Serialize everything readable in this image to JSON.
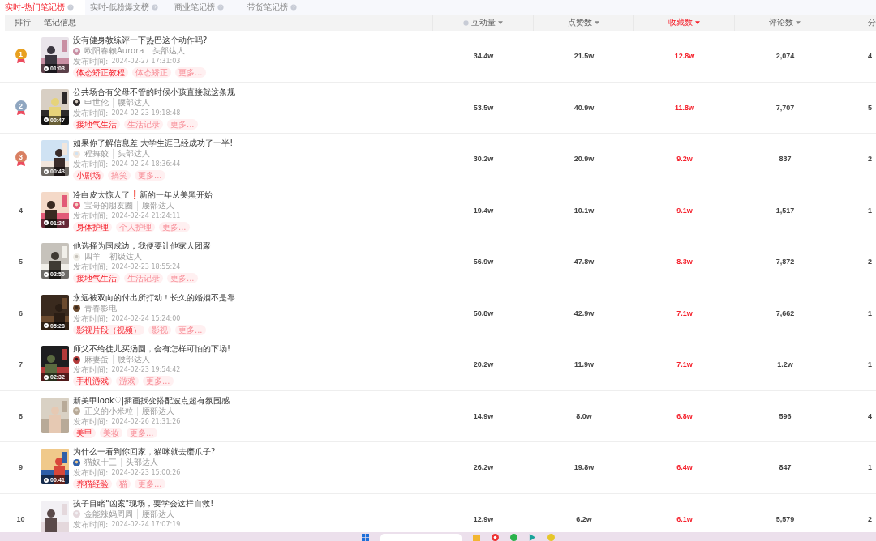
{
  "tabs": [
    {
      "label": "实时-热门笔记榜",
      "selected": true
    },
    {
      "label": "实时-低粉爆文榜",
      "selected": false
    },
    {
      "label": "商业笔记榜",
      "selected": false
    },
    {
      "label": "带货笔记榜",
      "selected": false
    }
  ],
  "columns": [
    {
      "label": "排行",
      "kind": "rank",
      "sorted": false
    },
    {
      "label": "笔记信息",
      "kind": "note",
      "sorted": false
    },
    {
      "label": "互动量",
      "kind": "hinted",
      "sorted": false
    },
    {
      "label": "点赞数",
      "kind": "metric",
      "sorted": false
    },
    {
      "label": "收藏数",
      "kind": "metric",
      "sorted": true
    },
    {
      "label": "评论数",
      "kind": "metric",
      "sorted": false
    },
    {
      "label": "分",
      "kind": "cut",
      "sorted": false
    }
  ],
  "rows": [
    {
      "rank": "1",
      "color": "#e8a020",
      "title": "没有健身教练评一下热巴这个动作吗?",
      "author": "欧阳春赖Aurora",
      "level": "头部达人",
      "published_label": "发布时间:",
      "published": "2024-02-27 17:31:03",
      "duration": "01:03",
      "tags": [
        {
          "label": "体态矫正教程",
          "kind": "category"
        },
        {
          "label": "体态矫正",
          "kind": "topic"
        },
        {
          "label": "更多...",
          "kind": "more"
        }
      ],
      "metrics": [
        "34.4w",
        "21.5w",
        "12.8w",
        "2,074",
        "4"
      ]
    },
    {
      "rank": "2",
      "color": "#8fa6c0",
      "title": "公共场合有父母不管的时候小孩直接就这条规",
      "author": "申世伦",
      "level": "腰部达人",
      "published_label": "发布时间:",
      "published": "2024-02-23 19:18:48",
      "duration": "00:47",
      "tags": [
        {
          "label": "接地气生活",
          "kind": "category"
        },
        {
          "label": "生活记录",
          "kind": "topic"
        },
        {
          "label": "更多...",
          "kind": "more"
        }
      ],
      "metrics": [
        "53.5w",
        "40.9w",
        "11.8w",
        "7,707",
        "5"
      ]
    },
    {
      "rank": "3",
      "color": "#d98062",
      "title": "如果你了解信息差 大学生涯已经成功了一半!",
      "author": "程舞姣",
      "level": "头部达人",
      "published_label": "发布时间:",
      "published": "2024-02-24 18:36:44",
      "duration": "00:43",
      "tags": [
        {
          "label": "小剧场",
          "kind": "category"
        },
        {
          "label": "搞笑",
          "kind": "topic"
        },
        {
          "label": "更多...",
          "kind": "more"
        }
      ],
      "metrics": [
        "30.2w",
        "20.9w",
        "9.2w",
        "837",
        "2"
      ]
    },
    {
      "rank": "4",
      "title": "冷白皮太惊人了❗新的一年从美黑开始",
      "author": "宝哥的朋友圈",
      "level": "腰部达人",
      "published_label": "发布时间:",
      "published": "2024-02-24 21:24:11",
      "duration": "01:24",
      "tags": [
        {
          "label": "身体护理",
          "kind": "category"
        },
        {
          "label": "个人护理",
          "kind": "topic"
        },
        {
          "label": "更多...",
          "kind": "more"
        }
      ],
      "metrics": [
        "19.4w",
        "10.1w",
        "9.1w",
        "1,517",
        "1"
      ]
    },
    {
      "rank": "5",
      "title": "他选择为国戍边，我便要让他家人团聚",
      "author": "四羊",
      "level": "初级达人",
      "published_label": "发布时间:",
      "published": "2024-02-23 18:55:24",
      "duration": "02:50",
      "tags": [
        {
          "label": "接地气生活",
          "kind": "category"
        },
        {
          "label": "生活记录",
          "kind": "topic"
        },
        {
          "label": "更多...",
          "kind": "more"
        }
      ],
      "metrics": [
        "56.9w",
        "47.8w",
        "8.3w",
        "7,872",
        "2"
      ]
    },
    {
      "rank": "6",
      "title": "永远被双向的付出所打动！长久的婚姻不是靠",
      "author": "青春影电",
      "published_label": "发布时间:",
      "published": "2024-02-24 15:24:00",
      "duration": "05:28",
      "tags": [
        {
          "label": "影视片段（视频）",
          "kind": "category"
        },
        {
          "label": "影视",
          "kind": "topic"
        },
        {
          "label": "更多...",
          "kind": "more"
        }
      ],
      "metrics": [
        "50.8w",
        "42.9w",
        "7.1w",
        "7,662",
        "1"
      ]
    },
    {
      "rank": "7",
      "title": "师父不给徒儿买汤圆，会有怎样可怕的下场!",
      "author": "麻妻蛋",
      "level": "腰部达人",
      "published_label": "发布时间:",
      "published": "2024-02-23 19:54:42",
      "duration": "02:32",
      "tags": [
        {
          "label": "手机游戏",
          "kind": "category"
        },
        {
          "label": "游戏",
          "kind": "topic"
        },
        {
          "label": "更多...",
          "kind": "more"
        }
      ],
      "metrics": [
        "20.2w",
        "11.9w",
        "7.1w",
        "1.2w",
        "1"
      ]
    },
    {
      "rank": "8",
      "title": "新美甲look♡|插画扳变搭配波点超有氛围感",
      "author": "正义的小米粒",
      "level": "腰部达人",
      "published_label": "发布时间:",
      "published": "2024-02-26 21:31:26",
      "tags": [
        {
          "label": "美甲",
          "kind": "category"
        },
        {
          "label": "美妆",
          "kind": "topic"
        },
        {
          "label": "更多...",
          "kind": "more"
        }
      ],
      "metrics": [
        "14.9w",
        "8.0w",
        "6.8w",
        "596",
        "4"
      ]
    },
    {
      "rank": "9",
      "title": "为什么一看到你回家，猫咪就去磨爪子?",
      "author": "猫奴十三",
      "level": "头部达人",
      "published_label": "发布时间:",
      "published": "2024-02-23 15:00:26",
      "duration": "00:41",
      "tags": [
        {
          "label": "养猫经验",
          "kind": "category"
        },
        {
          "label": "猫",
          "kind": "topic"
        },
        {
          "label": "更多...",
          "kind": "more"
        }
      ],
      "metrics": [
        "26.2w",
        "19.8w",
        "6.4w",
        "847",
        "1"
      ]
    },
    {
      "rank": "10",
      "title": "孩子目睹\"凶案\"现场，要学会这样自救!",
      "author": "金能辣妈周周",
      "level": "腰部达人",
      "published_label": "发布时间:",
      "published": "2024-02-24 17:07:19",
      "metrics": [
        "12.9w",
        "6.2w",
        "6.1w",
        "5,579",
        "2"
      ]
    }
  ]
}
